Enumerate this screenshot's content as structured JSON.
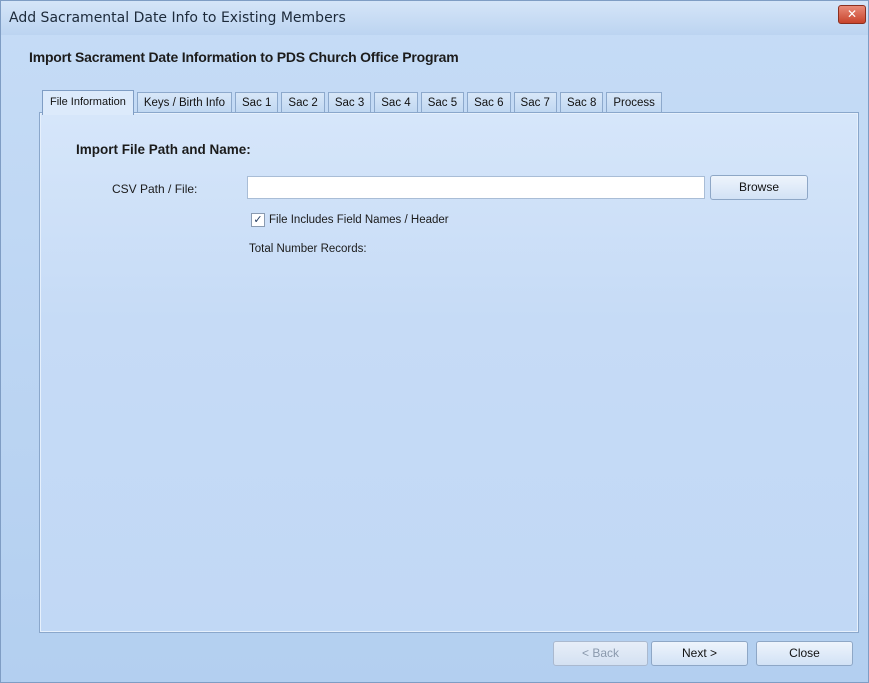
{
  "window": {
    "title": "Add Sacramental Date Info to Existing Members",
    "close_glyph": "✕"
  },
  "header": {
    "subtitle": "Import Sacrament Date Information to PDS Church Office Program"
  },
  "tabs": [
    {
      "label": "File Information",
      "active": true
    },
    {
      "label": "Keys / Birth Info",
      "active": false
    },
    {
      "label": "Sac 1",
      "active": false
    },
    {
      "label": "Sac 2",
      "active": false
    },
    {
      "label": "Sac 3",
      "active": false
    },
    {
      "label": "Sac 4",
      "active": false
    },
    {
      "label": "Sac 5",
      "active": false
    },
    {
      "label": "Sac 6",
      "active": false
    },
    {
      "label": "Sac 7",
      "active": false
    },
    {
      "label": "Sac 8",
      "active": false
    },
    {
      "label": "Process",
      "active": false
    }
  ],
  "file_info": {
    "section_label": "Import File Path and Name:",
    "csv_label": "CSV Path / File:",
    "csv_value": "",
    "browse_label": "Browse",
    "header_checkbox_label": "File Includes Field Names / Header",
    "header_checkbox_checked": true,
    "checkmark_glyph": "✓",
    "total_records_label": "Total Number Records:"
  },
  "footer": {
    "back_label": "< Back",
    "next_label": "Next >",
    "close_label": "Close"
  }
}
